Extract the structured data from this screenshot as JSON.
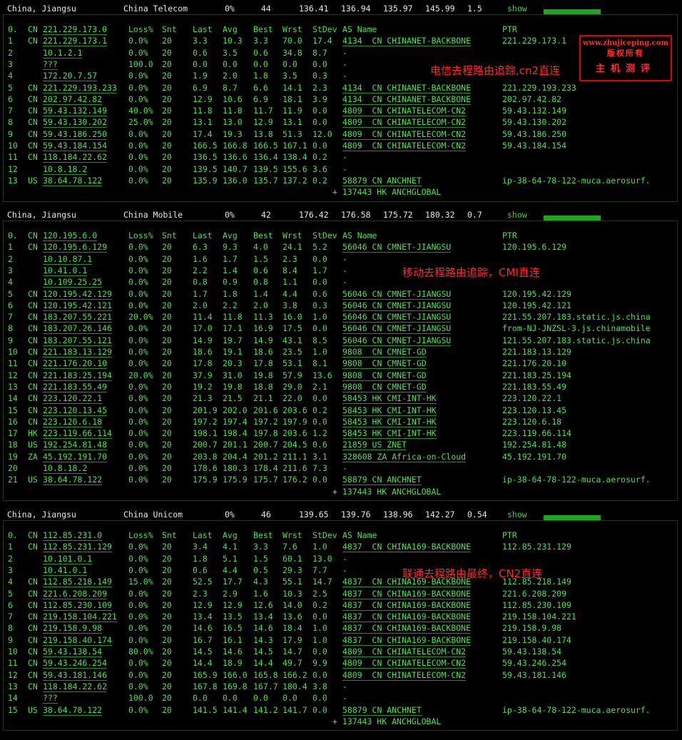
{
  "sections": [
    {
      "summary": {
        "region": "China, Jiangsu",
        "isp": "China Telecom",
        "loss": "0%",
        "snt": "44",
        "last": "136.41",
        "avg": "136.94",
        "best": "135.97",
        "wrst": "145.99",
        "stdev": "1.5",
        "show": "show"
      },
      "note": "电信去程路由追踪,cn2直连",
      "header": {
        "hop": "0.",
        "cc": "CN",
        "ip": "221.229.173.0",
        "loss": "Loss%",
        "snt": "Snt",
        "last": "Last",
        "avg": "Avg",
        "best": "Best",
        "wrst": "Wrst",
        "stdev": "StDev",
        "as": "AS Name",
        "ptr": "PTR"
      },
      "rows": [
        {
          "hop": "1",
          "cc": "CN",
          "ip": "221.229.173.1",
          "loss": "0.0%",
          "snt": "20",
          "last": "3.3",
          "avg": "10.3",
          "best": "3.3",
          "wrst": "70.0",
          "stdev": "17.4",
          "as": "4134  CN CHINANET-BACKBONE",
          "ptr": "221.229.173.1"
        },
        {
          "hop": "2",
          "cc": "",
          "ip": "10.1.2.1",
          "loss": "0.0%",
          "snt": "20",
          "last": "0.6",
          "avg": "3.5",
          "best": "0.6",
          "wrst": "34.8",
          "stdev": "8.7",
          "as": "-",
          "ptr": ""
        },
        {
          "hop": "3",
          "cc": "",
          "ip": "???",
          "loss": "100.0",
          "snt": "20",
          "last": "0.0",
          "avg": "0.0",
          "best": "0.0",
          "wrst": "0.0",
          "stdev": "0.0",
          "as": "-",
          "ptr": ""
        },
        {
          "hop": "4",
          "cc": "",
          "ip": "172.20.7.57",
          "loss": "0.0%",
          "snt": "20",
          "last": "1.9",
          "avg": "2.0",
          "best": "1.8",
          "wrst": "3.5",
          "stdev": "0.3",
          "as": "-",
          "ptr": ""
        },
        {
          "hop": "5",
          "cc": "CN",
          "ip": "221.229.193.233",
          "loss": "0.0%",
          "snt": "20",
          "last": "6.9",
          "avg": "8.7",
          "best": "6.6",
          "wrst": "14.1",
          "stdev": "2.3",
          "as": "4134  CN CHINANET-BACKBONE",
          "ptr": "221.229.193.233"
        },
        {
          "hop": "6",
          "cc": "CN",
          "ip": "202.97.42.82",
          "loss": "0.0%",
          "snt": "20",
          "last": "12.9",
          "avg": "10.6",
          "best": "6.9",
          "wrst": "18.1",
          "stdev": "3.9",
          "as": "4134  CN CHINANET-BACKBONE",
          "ptr": "202.97.42.82"
        },
        {
          "hop": "7",
          "cc": "CN",
          "ip": "59.43.132.149",
          "loss": "40.0%",
          "snt": "20",
          "last": "11.8",
          "avg": "11.8",
          "best": "11.7",
          "wrst": "11.9",
          "stdev": "0.0",
          "as": "4809  CN CHINATELECOM-CN2",
          "ptr": "59.43.132.149"
        },
        {
          "hop": "8",
          "cc": "CN",
          "ip": "59.43.130.202",
          "loss": "25.0%",
          "snt": "20",
          "last": "13.1",
          "avg": "13.0",
          "best": "12.9",
          "wrst": "13.1",
          "stdev": "0.0",
          "as": "4809  CN CHINATELECOM-CN2",
          "ptr": "59.43.130.202"
        },
        {
          "hop": "9",
          "cc": "CN",
          "ip": "59.43.186.250",
          "loss": "0.0%",
          "snt": "20",
          "last": "17.4",
          "avg": "19.3",
          "best": "13.8",
          "wrst": "51.3",
          "stdev": "12.0",
          "as": "4809  CN CHINATELECOM-CN2",
          "ptr": "59.43.186.250"
        },
        {
          "hop": "10",
          "cc": "CN",
          "ip": "59.43.184.154",
          "loss": "0.0%",
          "snt": "20",
          "last": "166.5",
          "avg": "166.8",
          "best": "166.5",
          "wrst": "167.1",
          "stdev": "0.0",
          "as": "4809  CN CHINATELECOM-CN2",
          "ptr": "59.43.184.154"
        },
        {
          "hop": "11",
          "cc": "CN",
          "ip": "118.184.22.62",
          "loss": "0.0%",
          "snt": "20",
          "last": "136.5",
          "avg": "136.6",
          "best": "136.4",
          "wrst": "138.4",
          "stdev": "0.2",
          "as": "-",
          "ptr": ""
        },
        {
          "hop": "12",
          "cc": "",
          "ip": "10.8.18.2",
          "loss": "0.0%",
          "snt": "20",
          "last": "139.5",
          "avg": "140.7",
          "best": "139.5",
          "wrst": "155.6",
          "stdev": "3.6",
          "as": "-",
          "ptr": ""
        },
        {
          "hop": "13",
          "cc": "US",
          "ip": "38.64.78.122",
          "loss": "0.0%",
          "snt": "20",
          "last": "135.9",
          "avg": "136.0",
          "best": "135.7",
          "wrst": "137.2",
          "stdev": "0.2",
          "as": "58879 CN ANCHNET",
          "ptr": "ip-38-64-78-122-muca.aerosurf."
        }
      ],
      "extra": "+ 137443 HK ANCHGLOBAL"
    },
    {
      "summary": {
        "region": "China, Jiangsu",
        "isp": "China Mobile",
        "loss": "0%",
        "snt": "42",
        "last": "176.42",
        "avg": "176.58",
        "best": "175.72",
        "wrst": "180.32",
        "stdev": "0.7",
        "show": "show"
      },
      "note": "移动去程路由追踪，CMI直连",
      "header": {
        "hop": "0.",
        "cc": "CN",
        "ip": "120.195.6.0",
        "loss": "Loss%",
        "snt": "Snt",
        "last": "Last",
        "avg": "Avg",
        "best": "Best",
        "wrst": "Wrst",
        "stdev": "StDev",
        "as": "AS Name",
        "ptr": "PTR"
      },
      "rows": [
        {
          "hop": "1",
          "cc": "CN",
          "ip": "120.195.6.129",
          "loss": "0.0%",
          "snt": "20",
          "last": "6.3",
          "avg": "9.3",
          "best": "4.0",
          "wrst": "24.1",
          "stdev": "5.2",
          "as": "56046 CN CMNET-JIANGSU",
          "ptr": "120.195.6.129"
        },
        {
          "hop": "2",
          "cc": "",
          "ip": "10.10.87.1",
          "loss": "0.0%",
          "snt": "20",
          "last": "1.6",
          "avg": "1.7",
          "best": "1.5",
          "wrst": "2.3",
          "stdev": "0.0",
          "as": "-",
          "ptr": ""
        },
        {
          "hop": "3",
          "cc": "",
          "ip": "10.41.0.1",
          "loss": "0.0%",
          "snt": "20",
          "last": "2.2",
          "avg": "1.4",
          "best": "0.6",
          "wrst": "8.4",
          "stdev": "1.7",
          "as": "-",
          "ptr": ""
        },
        {
          "hop": "4",
          "cc": "",
          "ip": "10.109.25.25",
          "loss": "0.0%",
          "snt": "20",
          "last": "0.8",
          "avg": "0.9",
          "best": "0.8",
          "wrst": "1.1",
          "stdev": "0.0",
          "as": "-",
          "ptr": ""
        },
        {
          "hop": "5",
          "cc": "CN",
          "ip": "120.195.42.129",
          "loss": "0.0%",
          "snt": "20",
          "last": "1.7",
          "avg": "1.8",
          "best": "1.4",
          "wrst": "4.4",
          "stdev": "0.6",
          "as": "56046 CN CMNET-JIANGSU",
          "ptr": "120.195.42.129"
        },
        {
          "hop": "6",
          "cc": "CN",
          "ip": "120.195.42.121",
          "loss": "0.0%",
          "snt": "20",
          "last": "2.0",
          "avg": "2.2",
          "best": "2.0",
          "wrst": "3.8",
          "stdev": "0.3",
          "as": "56046 CN CMNET-JIANGSU",
          "ptr": "120.195.42.121"
        },
        {
          "hop": "7",
          "cc": "CN",
          "ip": "183.207.55.221",
          "loss": "20.0%",
          "snt": "20",
          "last": "11.4",
          "avg": "11.8",
          "best": "11.3",
          "wrst": "16.0",
          "stdev": "1.0",
          "as": "56046 CN CMNET-JIANGSU",
          "ptr": "221.55.207.183.static.js.china"
        },
        {
          "hop": "8",
          "cc": "CN",
          "ip": "183.207.26.146",
          "loss": "0.0%",
          "snt": "20",
          "last": "17.0",
          "avg": "17.1",
          "best": "16.9",
          "wrst": "17.5",
          "stdev": "0.0",
          "as": "56046 CN CMNET-JIANGSU",
          "ptr": "from-NJ-JNZSL-3.js.chinamobile"
        },
        {
          "hop": "9",
          "cc": "CN",
          "ip": "183.207.55.121",
          "loss": "0.0%",
          "snt": "20",
          "last": "14.9",
          "avg": "19.7",
          "best": "14.9",
          "wrst": "43.1",
          "stdev": "8.5",
          "as": "56046 CN CMNET-JIANGSU",
          "ptr": "121.55.207.183.static.js.china"
        },
        {
          "hop": "10",
          "cc": "CN",
          "ip": "221.183.13.129",
          "loss": "0.0%",
          "snt": "20",
          "last": "18.6",
          "avg": "19.1",
          "best": "18.6",
          "wrst": "23.5",
          "stdev": "1.0",
          "as": "9808  CN CMNET-GD",
          "ptr": "221.183.13.129"
        },
        {
          "hop": "11",
          "cc": "CN",
          "ip": "221.176.20.10",
          "loss": "0.0%",
          "snt": "20",
          "last": "17.8",
          "avg": "20.3",
          "best": "17.8",
          "wrst": "53.1",
          "stdev": "8.1",
          "as": "9808  CN CMNET-GD",
          "ptr": "221.176.20.10"
        },
        {
          "hop": "12",
          "cc": "CN",
          "ip": "221.183.25.194",
          "loss": "20.0%",
          "snt": "20",
          "last": "37.9",
          "avg": "31.0",
          "best": "19.8",
          "wrst": "57.9",
          "stdev": "13.6",
          "as": "9808  CN CMNET-GD",
          "ptr": "221.183.25.194"
        },
        {
          "hop": "13",
          "cc": "CN",
          "ip": "221.183.55.49",
          "loss": "0.0%",
          "snt": "20",
          "last": "19.2",
          "avg": "19.8",
          "best": "18.8",
          "wrst": "29.0",
          "stdev": "2.1",
          "as": "9808  CN CMNET-GD",
          "ptr": "221.183.55.49"
        },
        {
          "hop": "14",
          "cc": "CN",
          "ip": "223.120.22.1",
          "loss": "0.0%",
          "snt": "20",
          "last": "21.3",
          "avg": "21.5",
          "best": "21.1",
          "wrst": "22.0",
          "stdev": "0.0",
          "as": "58453 HK CMI-INT-HK",
          "ptr": "223.120.22.1"
        },
        {
          "hop": "15",
          "cc": "CN",
          "ip": "223.120.13.45",
          "loss": "0.0%",
          "snt": "20",
          "last": "201.9",
          "avg": "202.0",
          "best": "201.6",
          "wrst": "203.6",
          "stdev": "0.2",
          "as": "58453 HK CMI-INT-HK",
          "ptr": "223.120.13.45"
        },
        {
          "hop": "16",
          "cc": "CN",
          "ip": "223.120.6.18",
          "loss": "0.0%",
          "snt": "20",
          "last": "197.2",
          "avg": "197.4",
          "best": "197.2",
          "wrst": "197.9",
          "stdev": "0.0",
          "as": "58453 HK CMI-INT-HK",
          "ptr": "223.120.6.18"
        },
        {
          "hop": "17",
          "cc": "HK",
          "ip": "223.119.66.114",
          "loss": "0.0%",
          "snt": "20",
          "last": "198.1",
          "avg": "198.4",
          "best": "197.8",
          "wrst": "203.6",
          "stdev": "1.2",
          "as": "58453 HK CMI-INT-HK",
          "ptr": "223.119.66.114"
        },
        {
          "hop": "18",
          "cc": "US",
          "ip": "192.254.81.48",
          "loss": "0.0%",
          "snt": "20",
          "last": "200.7",
          "avg": "201.1",
          "best": "200.7",
          "wrst": "204.5",
          "stdev": "0.6",
          "as": "21859 US ZNET",
          "ptr": "192.254.81.48"
        },
        {
          "hop": "19",
          "cc": "ZA",
          "ip": "45.192.191.70",
          "loss": "0.0%",
          "snt": "20",
          "last": "203.8",
          "avg": "204.4",
          "best": "201.2",
          "wrst": "211.1",
          "stdev": "3.1",
          "as": "328608 ZA Africa-on-Cloud",
          "ptr": "45.192.191.70"
        },
        {
          "hop": "20",
          "cc": "",
          "ip": "10.8.18.2",
          "loss": "0.0%",
          "snt": "20",
          "last": "178.6",
          "avg": "180.3",
          "best": "178.4",
          "wrst": "211.6",
          "stdev": "7.3",
          "as": "-",
          "ptr": ""
        },
        {
          "hop": "21",
          "cc": "US",
          "ip": "38.64.78.122",
          "loss": "0.0%",
          "snt": "20",
          "last": "175.9",
          "avg": "175.9",
          "best": "175.7",
          "wrst": "176.2",
          "stdev": "0.0",
          "as": "58879 CN ANCHNET",
          "ptr": "ip-38-64-78-122-muca.aerosurf."
        }
      ],
      "extra": "+ 137443 HK ANCHGLOBAL"
    },
    {
      "summary": {
        "region": "China, Jiangsu",
        "isp": "China Unicom",
        "loss": "0%",
        "snt": "46",
        "last": "139.65",
        "avg": "139.76",
        "best": "138.96",
        "wrst": "142.27",
        "stdev": "0.54",
        "show": "show"
      },
      "note": "联通去程路由最终，CN2直连",
      "header": {
        "hop": "0.",
        "cc": "CN",
        "ip": "112.85.231.0",
        "loss": "Loss%",
        "snt": "Snt",
        "last": "Last",
        "avg": "Avg",
        "best": "Best",
        "wrst": "Wrst",
        "stdev": "StDev",
        "as": "AS Name",
        "ptr": "PTR"
      },
      "rows": [
        {
          "hop": "1",
          "cc": "CN",
          "ip": "112.85.231.129",
          "loss": "0.0%",
          "snt": "20",
          "last": "3.4",
          "avg": "4.1",
          "best": "3.3",
          "wrst": "7.6",
          "stdev": "1.0",
          "as": "4837  CN CHINA169-BACKBONE",
          "ptr": "112.85.231.129"
        },
        {
          "hop": "2",
          "cc": "",
          "ip": "10.101.0.1",
          "loss": "0.0%",
          "snt": "20",
          "last": "1.8",
          "avg": "5.1",
          "best": "1.5",
          "wrst": "60.1",
          "stdev": "13.0",
          "as": "-",
          "ptr": ""
        },
        {
          "hop": "3",
          "cc": "",
          "ip": "10.41.0.1",
          "loss": "0.0%",
          "snt": "20",
          "last": "0.6",
          "avg": "4.4",
          "best": "0.5",
          "wrst": "29.3",
          "stdev": "7.7",
          "as": "-",
          "ptr": ""
        },
        {
          "hop": "4",
          "cc": "CN",
          "ip": "112.85.218.149",
          "loss": "15.0%",
          "snt": "20",
          "last": "52.5",
          "avg": "17.7",
          "best": "4.3",
          "wrst": "55.1",
          "stdev": "14.7",
          "as": "4837  CN CHINA169-BACKBONE",
          "ptr": "112.85.218.149"
        },
        {
          "hop": "5",
          "cc": "CN",
          "ip": "221.6.208.209",
          "loss": "0.0%",
          "snt": "20",
          "last": "2.3",
          "avg": "2.9",
          "best": "1.6",
          "wrst": "10.3",
          "stdev": "2.5",
          "as": "4837  CN CHINA169-BACKBONE",
          "ptr": "221.6.208.209"
        },
        {
          "hop": "6",
          "cc": "CN",
          "ip": "112.85.230.109",
          "loss": "0.0%",
          "snt": "20",
          "last": "12.9",
          "avg": "12.9",
          "best": "12.6",
          "wrst": "14.0",
          "stdev": "0.2",
          "as": "4837  CN CHINA169-BACKBONE",
          "ptr": "112.85.230.109"
        },
        {
          "hop": "7",
          "cc": "CN",
          "ip": "219.158.104.221",
          "loss": "0.0%",
          "snt": "20",
          "last": "13.4",
          "avg": "13.5",
          "best": "13.4",
          "wrst": "13.6",
          "stdev": "0.0",
          "as": "4837  CN CHINA169-BACKBONE",
          "ptr": "219.158.104.221"
        },
        {
          "hop": "8",
          "cc": "CN",
          "ip": "219.158.9.98",
          "loss": "0.0%",
          "snt": "20",
          "last": "14.6",
          "avg": "16.5",
          "best": "14.6",
          "wrst": "18.4",
          "stdev": "1.0",
          "as": "4837  CN CHINA169-BACKBONE",
          "ptr": "219.158.9.98"
        },
        {
          "hop": "9",
          "cc": "CN",
          "ip": "219.158.40.174",
          "loss": "0.0%",
          "snt": "20",
          "last": "16.7",
          "avg": "16.1",
          "best": "14.3",
          "wrst": "17.9",
          "stdev": "1.0",
          "as": "4837  CN CHINA169-BACKBONE",
          "ptr": "219.158.40.174"
        },
        {
          "hop": "10",
          "cc": "CN",
          "ip": "59.43.138.54",
          "loss": "80.0%",
          "snt": "20",
          "last": "14.5",
          "avg": "14.6",
          "best": "14.5",
          "wrst": "14.7",
          "stdev": "0.0",
          "as": "4809  CN CHINATELECOM-CN2",
          "ptr": "59.43.138.54"
        },
        {
          "hop": "11",
          "cc": "CN",
          "ip": "59.43.246.254",
          "loss": "0.0%",
          "snt": "20",
          "last": "14.4",
          "avg": "18.9",
          "best": "14.4",
          "wrst": "49.7",
          "stdev": "9.9",
          "as": "4809  CN CHINATELECOM-CN2",
          "ptr": "59.43.246.254"
        },
        {
          "hop": "12",
          "cc": "CN",
          "ip": "59.43.181.146",
          "loss": "0.0%",
          "snt": "20",
          "last": "165.9",
          "avg": "166.0",
          "best": "165.8",
          "wrst": "166.2",
          "stdev": "0.0",
          "as": "4809  CN CHINATELECOM-CN2",
          "ptr": "59.43.181.146"
        },
        {
          "hop": "13",
          "cc": "CN",
          "ip": "118.184.22.62",
          "loss": "0.0%",
          "snt": "20",
          "last": "167.8",
          "avg": "169.8",
          "best": "167.7",
          "wrst": "180.4",
          "stdev": "3.8",
          "as": "-",
          "ptr": ""
        },
        {
          "hop": "14",
          "cc": "",
          "ip": "???",
          "loss": "100.0",
          "snt": "20",
          "last": "0.0",
          "avg": "0.0",
          "best": "0.0",
          "wrst": "0.0",
          "stdev": "0.0",
          "as": "-",
          "ptr": ""
        },
        {
          "hop": "15",
          "cc": "US",
          "ip": "38.64.78.122",
          "loss": "0.0%",
          "snt": "20",
          "last": "141.5",
          "avg": "141.4",
          "best": "141.2",
          "wrst": "141.7",
          "stdev": "0.0",
          "as": "58879 CN ANCHNET",
          "ptr": "ip-38-64-78-122-muca.aerosurf."
        }
      ],
      "extra": "+ 137443 HK ANCHGLOBAL"
    }
  ],
  "logo": {
    "line1": "www.zhujiceping.com",
    "line2": "版权所有",
    "line3": "主机测评"
  },
  "colors": {
    "text": "#4fe04f",
    "summary": "#e6e6e6",
    "note": "#ff2a2a",
    "bar": "#1fa51f"
  }
}
